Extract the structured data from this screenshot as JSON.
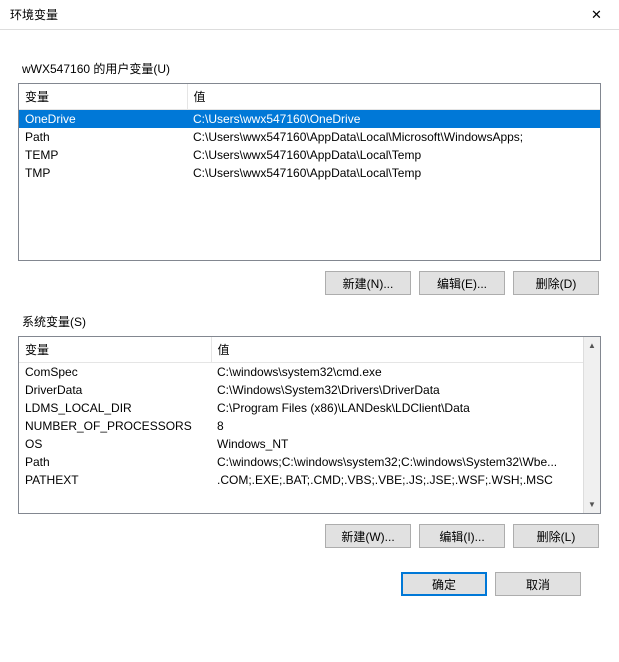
{
  "window": {
    "title": "环境变量",
    "close_glyph": "✕"
  },
  "user_section": {
    "label": "wWX547160 的用户变量(U)",
    "headers": {
      "name": "变量",
      "value": "值"
    },
    "rows": [
      {
        "name": "OneDrive",
        "value": "C:\\Users\\wwx547160\\OneDrive",
        "selected": true
      },
      {
        "name": "Path",
        "value": "C:\\Users\\wwx547160\\AppData\\Local\\Microsoft\\WindowsApps;",
        "selected": false
      },
      {
        "name": "TEMP",
        "value": "C:\\Users\\wwx547160\\AppData\\Local\\Temp",
        "selected": false
      },
      {
        "name": "TMP",
        "value": "C:\\Users\\wwx547160\\AppData\\Local\\Temp",
        "selected": false
      }
    ],
    "buttons": {
      "new": "新建(N)...",
      "edit": "编辑(E)...",
      "delete": "删除(D)"
    }
  },
  "system_section": {
    "label": "系统变量(S)",
    "headers": {
      "name": "变量",
      "value": "值"
    },
    "rows": [
      {
        "name": "ComSpec",
        "value": "C:\\windows\\system32\\cmd.exe"
      },
      {
        "name": "DriverData",
        "value": "C:\\Windows\\System32\\Drivers\\DriverData"
      },
      {
        "name": "LDMS_LOCAL_DIR",
        "value": "C:\\Program Files (x86)\\LANDesk\\LDClient\\Data"
      },
      {
        "name": "NUMBER_OF_PROCESSORS",
        "value": "8"
      },
      {
        "name": "OS",
        "value": "Windows_NT"
      },
      {
        "name": "Path",
        "value": "C:\\windows;C:\\windows\\system32;C:\\windows\\System32\\Wbe..."
      },
      {
        "name": "PATHEXT",
        "value": ".COM;.EXE;.BAT;.CMD;.VBS;.VBE;.JS;.JSE;.WSF;.WSH;.MSC"
      }
    ],
    "buttons": {
      "new": "新建(W)...",
      "edit": "编辑(I)...",
      "delete": "删除(L)"
    }
  },
  "footer": {
    "ok": "确定",
    "cancel": "取消"
  },
  "glyphs": {
    "up": "▲",
    "down": "▼"
  }
}
